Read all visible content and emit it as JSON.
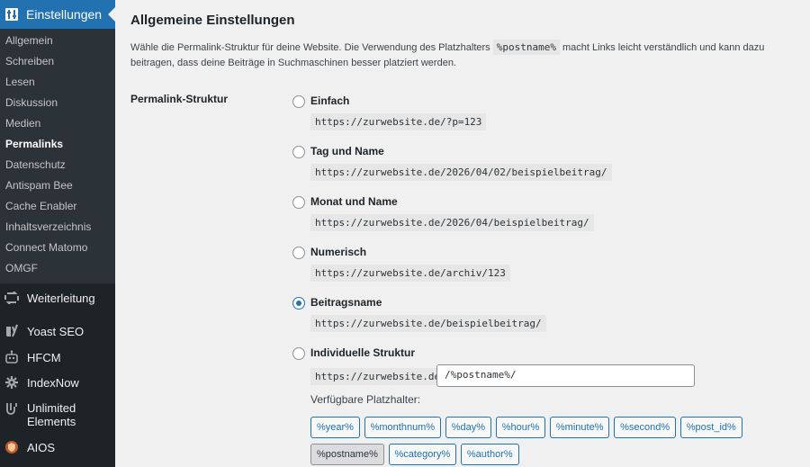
{
  "sidebar": {
    "header": "Einstellungen",
    "sub_items": [
      {
        "label": "Allgemein",
        "active": false
      },
      {
        "label": "Schreiben",
        "active": false
      },
      {
        "label": "Lesen",
        "active": false
      },
      {
        "label": "Diskussion",
        "active": false
      },
      {
        "label": "Medien",
        "active": false
      },
      {
        "label": "Permalinks",
        "active": true
      },
      {
        "label": "Datenschutz",
        "active": false
      },
      {
        "label": "Antispam Bee",
        "active": false
      },
      {
        "label": "Cache Enabler",
        "active": false
      },
      {
        "label": "Inhaltsverzeichnis",
        "active": false
      },
      {
        "label": "Connect Matomo",
        "active": false
      },
      {
        "label": "OMGF",
        "active": false
      }
    ],
    "menu_items": [
      {
        "label": "Weiterleitung",
        "icon": "redirect-icon"
      },
      {
        "label": "Yoast SEO",
        "icon": "yoast-icon"
      },
      {
        "label": "HFCM",
        "icon": "robot-icon"
      },
      {
        "label": "IndexNow",
        "icon": "gear-icon"
      },
      {
        "label": "Unlimited Elements",
        "icon": "unlimited-elements-icon"
      },
      {
        "label": "AIOS",
        "icon": "shield-icon"
      }
    ]
  },
  "main": {
    "section_title": "Allgemeine Einstellungen",
    "intro_before": "Wähle die Permalink-Struktur für deine Website. Die Verwendung des Platzhalters ",
    "intro_code": "%postname%",
    "intro_after": " macht Links leicht verständlich und kann dazu beitragen, dass deine Beiträge in Suchmaschinen besser platziert werden.",
    "field_label": "Permalink-Struktur",
    "options": [
      {
        "label": "Einfach",
        "example": "https://zurwebsite.de/?p=123",
        "checked": false
      },
      {
        "label": "Tag und Name",
        "example": "https://zurwebsite.de/2026/04/02/beispielbeitrag/",
        "checked": false
      },
      {
        "label": "Monat und Name",
        "example": "https://zurwebsite.de/2026/04/beispielbeitrag/",
        "checked": false
      },
      {
        "label": "Numerisch",
        "example": "https://zurwebsite.de/archiv/123",
        "checked": false
      },
      {
        "label": "Beitragsname",
        "example": "https://zurwebsite.de/beispielbeitrag/",
        "checked": true
      },
      {
        "label": "Individuelle Struktur",
        "example": "",
        "checked": false
      }
    ],
    "custom": {
      "base": "https://zurwebsite.de",
      "value": "/%postname%/"
    },
    "available_label": "Verfügbare Platzhalter:",
    "tags": [
      {
        "label": "%year%",
        "pressed": false
      },
      {
        "label": "%monthnum%",
        "pressed": false
      },
      {
        "label": "%day%",
        "pressed": false
      },
      {
        "label": "%hour%",
        "pressed": false
      },
      {
        "label": "%minute%",
        "pressed": false
      },
      {
        "label": "%second%",
        "pressed": false
      },
      {
        "label": "%post_id%",
        "pressed": false
      },
      {
        "label": "%postname%",
        "pressed": true
      },
      {
        "label": "%category%",
        "pressed": false
      },
      {
        "label": "%author%",
        "pressed": false
      }
    ]
  }
}
